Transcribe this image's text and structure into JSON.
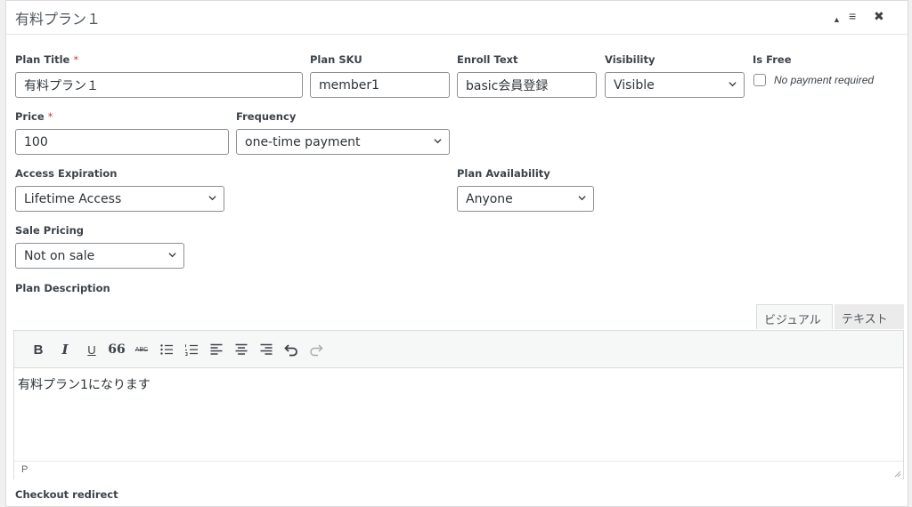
{
  "panel": {
    "title": "有料プラン１",
    "controls": {
      "collapse": "▲",
      "menu": "≡",
      "close": "✖"
    }
  },
  "fields": {
    "plan_title": {
      "label": "Plan Title",
      "required_mark": "*",
      "value": "有料プラン１"
    },
    "plan_sku": {
      "label": "Plan SKU",
      "value": "member1"
    },
    "enroll_text": {
      "label": "Enroll Text",
      "value": "basic会員登録"
    },
    "visibility": {
      "label": "Visibility",
      "value": "Visible"
    },
    "is_free": {
      "label": "Is Free",
      "checkbox_label": "No payment required",
      "checked": false
    },
    "price": {
      "label": "Price",
      "required_mark": "*",
      "value": "100"
    },
    "frequency": {
      "label": "Frequency",
      "value": "one-time payment"
    },
    "access_expiration": {
      "label": "Access Expiration",
      "value": "Lifetime Access"
    },
    "plan_availability": {
      "label": "Plan Availability",
      "value": "Anyone"
    },
    "sale_pricing": {
      "label": "Sale Pricing",
      "value": "Not on sale"
    },
    "plan_description": {
      "label": "Plan Description"
    }
  },
  "editor": {
    "tabs": {
      "visual": "ビジュアル",
      "text": "テキスト"
    },
    "toolbar_icons": [
      "bold-icon",
      "italic-icon",
      "underline-icon",
      "blockquote-icon",
      "strikethrough-icon",
      "bullet-list-icon",
      "numbered-list-icon",
      "align-left-icon",
      "align-center-icon",
      "align-right-icon",
      "undo-icon",
      "redo-icon"
    ],
    "toolbar_glyphs": {
      "bold": "B",
      "italic": "I",
      "underline": "U",
      "quote": "66",
      "strike": "ABC"
    },
    "content": "有料プラン1になります",
    "path": "P"
  },
  "next_section": {
    "label": "Checkout redirect"
  },
  "colors": {
    "required": "#d63638",
    "border": "#8c8f94",
    "toolbar_bg": "#f6f7f7"
  }
}
